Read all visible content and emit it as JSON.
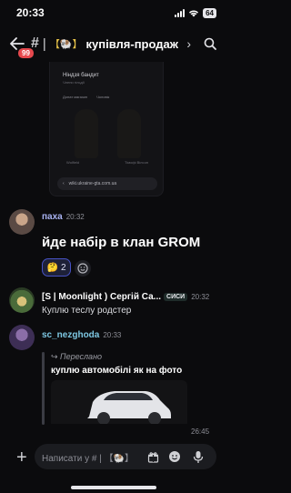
{
  "status": {
    "time": "20:33",
    "battery": "64"
  },
  "header": {
    "badge": "99",
    "hash": "#",
    "pipe": "|",
    "icon_text": "【🐏】",
    "channel_name": "купівля-продаж"
  },
  "embed": {
    "title": "Ніндзя бандит",
    "subtitle": "Члени гільдії",
    "actions": [
      "Донат магазин",
      "Чоловік"
    ],
    "labels": [
      "Wolfield",
      "Тімофі Вілсон"
    ],
    "url": "wiki.ukraine-gta.com.ua"
  },
  "messages": [
    {
      "author": "паха",
      "author_color": "#a9b3f2",
      "time": "20:32",
      "text": "йде набір в клан GROM",
      "reaction_emoji": "🤔",
      "reaction_count": "2"
    },
    {
      "author": "[S | Moonlight ) Сергій Са...",
      "author_color": "#ffffff",
      "badge": "СИСИ",
      "time": "20:32",
      "text": "Куплю теслу родстер"
    },
    {
      "author": "sc_nezghoda",
      "author_color": "#7ec8e3",
      "time": "20:33",
      "forwarded_label": "Переслано",
      "forwarded_text": "куплю автомобілі як на фото",
      "attachment_time": "26:45"
    }
  ],
  "composer": {
    "placeholder": "Написати у # | 【🐏】"
  },
  "colors": {
    "accent": "#5865f2",
    "background": "#0b0b0d",
    "badge_red": "#e5484d"
  }
}
